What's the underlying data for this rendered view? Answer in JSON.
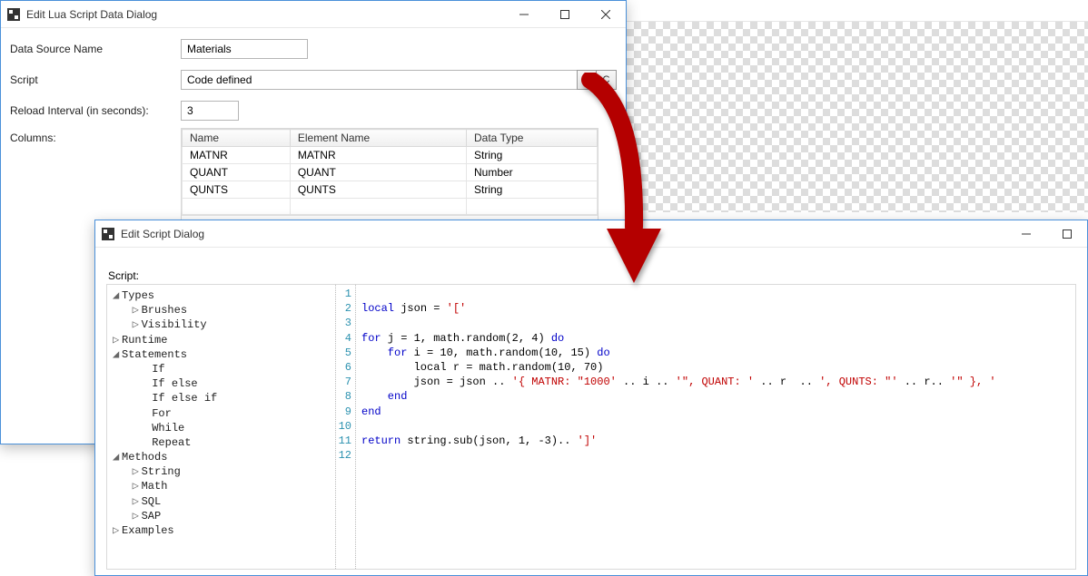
{
  "dlg1": {
    "title": "Edit Lua Script Data Dialog",
    "labels": {
      "dataSourceName": "Data Source Name",
      "script": "Script",
      "reloadInterval": "Reload Interval (in seconds):",
      "columns": "Columns:"
    },
    "values": {
      "dataSourceName": "Materials",
      "script": "Code defined",
      "reloadInterval": "3"
    },
    "buttons": {
      "x": "X",
      "c": "C"
    },
    "grid": {
      "headers": {
        "name": "Name",
        "elementName": "Element Name",
        "dataType": "Data Type"
      },
      "rows": [
        {
          "name": "MATNR",
          "elementName": "MATNR",
          "dataType": "String"
        },
        {
          "name": "QUANT",
          "elementName": "QUANT",
          "dataType": "Number"
        },
        {
          "name": "QUNTS",
          "elementName": "QUNTS",
          "dataType": "String"
        }
      ]
    }
  },
  "dlg2": {
    "title": "Edit Script Dialog",
    "scriptLabel": "Script:",
    "tree": {
      "types": "Types",
      "brushes": "Brushes",
      "visibility": "Visibility",
      "runtime": "Runtime",
      "statements": "Statements",
      "if": "If",
      "ifelse": "If else",
      "ifelseif": "If else if",
      "for": "For",
      "while": "While",
      "repeat": "Repeat",
      "methods": "Methods",
      "string": "String",
      "math": "Math",
      "sql": "SQL",
      "sap": "SAP",
      "examples": "Examples"
    },
    "lineCount": 12,
    "code": {
      "l2a": "local",
      "l2b": " json = ",
      "l2c": "'['",
      "l4a": "for",
      "l4b": " j = 1, math.random(2, 4) ",
      "l4c": "do",
      "l5a": "    for",
      "l5b": " i = 10, math.random(10, 15) ",
      "l5c": "do",
      "l6": "        local r = math.random(10, 70)",
      "l7a": "        json = json .. ",
      "l7b": "'{ MATNR: \"1000'",
      "l7c": " .. i .. ",
      "l7d": "'\", QUANT: '",
      "l7e": " .. r  .. ",
      "l7f": "', QUNTS: \"'",
      "l7g": " .. r.. ",
      "l7h": "'\" }, '",
      "l8": "    end",
      "l9": "end",
      "l11a": "return",
      "l11b": " string.sub(json, 1, -3).. ",
      "l11c": "']'"
    }
  }
}
